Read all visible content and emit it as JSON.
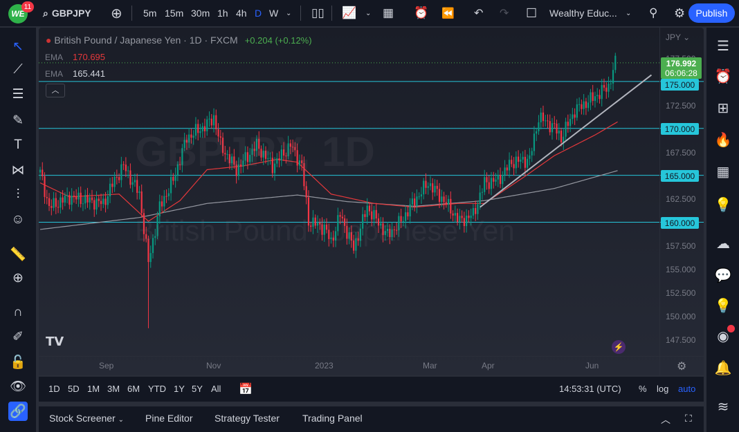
{
  "topbar": {
    "logo": "WE",
    "notifications": "11",
    "symbol": "GBPJPY",
    "intervals": [
      "5m",
      "15m",
      "30m",
      "1h",
      "4h",
      "D",
      "W"
    ],
    "active_interval": "D",
    "layout_name": "Wealthy Educ...",
    "publish": "Publish"
  },
  "legend": {
    "title": "British Pound / Japanese Yen · 1D · FXCM",
    "change": "+0.204 (+0.12%)",
    "ema1_label": "EMA",
    "ema1_value": "170.695",
    "ema2_label": "EMA",
    "ema2_value": "165.441"
  },
  "watermark": {
    "symbol": "GBPJPY, 1D",
    "name": "British Pound / Japanese Yen"
  },
  "price_axis": {
    "currency": "JPY",
    "labels": [
      "177.500",
      "172.500",
      "167.500",
      "162.500",
      "157.500",
      "155.000",
      "152.500",
      "150.000",
      "147.500"
    ],
    "last_price": "176.992",
    "countdown": "06:06:28",
    "line_tags": [
      "175.000",
      "170.000",
      "165.000",
      "160.000"
    ]
  },
  "time_axis": {
    "labels": [
      "Sep",
      "Nov",
      "2023",
      "Mar",
      "Apr",
      "Jun"
    ]
  },
  "range_bar": {
    "ranges": [
      "1D",
      "5D",
      "1M",
      "3M",
      "6M",
      "YTD",
      "1Y",
      "5Y",
      "All"
    ],
    "clock": "14:53:31 (UTC)",
    "percent": "%",
    "log": "log",
    "auto": "auto"
  },
  "bottom_tabs": [
    "Stock Screener",
    "Pine Editor",
    "Strategy Tester",
    "Trading Panel"
  ],
  "colors": {
    "up": "#089981",
    "down": "#f23645",
    "ema_fast": "#e5383b",
    "ema_slow": "#9598a1",
    "hline": "#26c6da",
    "accent": "#2962ff"
  },
  "chart_data": {
    "type": "candlestick",
    "bars": 256,
    "ylim": [
      146,
      179
    ],
    "close_waypoints": [
      [
        0,
        165.3
      ],
      [
        4,
        161.6
      ],
      [
        13,
        162.7
      ],
      [
        28,
        162
      ],
      [
        33,
        164.5
      ],
      [
        37,
        166
      ],
      [
        44,
        163
      ],
      [
        48,
        155.7
      ],
      [
        53,
        161.6
      ],
      [
        59,
        164.5
      ],
      [
        65,
        169
      ],
      [
        74,
        170.4
      ],
      [
        77,
        171.2
      ],
      [
        80,
        168.2
      ],
      [
        87,
        165.6
      ],
      [
        96,
        168.2
      ],
      [
        103,
        166
      ],
      [
        111,
        168.2
      ],
      [
        116,
        166
      ],
      [
        119,
        160.1
      ],
      [
        126,
        159.4
      ],
      [
        129,
        157.9
      ],
      [
        133,
        160.8
      ],
      [
        139,
        157.2
      ],
      [
        145,
        161.6
      ],
      [
        154,
        158.6
      ],
      [
        160,
        160.1
      ],
      [
        166,
        162.3
      ],
      [
        172,
        164.2
      ],
      [
        179,
        162.3
      ],
      [
        186,
        160.1
      ],
      [
        192,
        160.8
      ],
      [
        197,
        164.2
      ],
      [
        203,
        164.5
      ],
      [
        209,
        166.4
      ],
      [
        217,
        166.7
      ],
      [
        221,
        171.2
      ],
      [
        228,
        170.1
      ],
      [
        231,
        169
      ],
      [
        237,
        171.9
      ],
      [
        246,
        173.4
      ],
      [
        252,
        174.5
      ],
      [
        255,
        176.99
      ]
    ],
    "ema_fast": [
      [
        0,
        164.2
      ],
      [
        13,
        162.7
      ],
      [
        35,
        163
      ],
      [
        48,
        160.1
      ],
      [
        62,
        162.3
      ],
      [
        74,
        165.6
      ],
      [
        90,
        166
      ],
      [
        105,
        166.7
      ],
      [
        114,
        166.4
      ],
      [
        129,
        163
      ],
      [
        148,
        162
      ],
      [
        166,
        161.6
      ],
      [
        185,
        162
      ],
      [
        197,
        162
      ],
      [
        215,
        164.9
      ],
      [
        228,
        167.1
      ],
      [
        246,
        169.3
      ],
      [
        256,
        170.7
      ]
    ],
    "ema_slow": [
      [
        -1,
        159.2
      ],
      [
        44,
        160.5
      ],
      [
        74,
        162
      ],
      [
        114,
        162.9
      ],
      [
        136,
        162.2
      ],
      [
        166,
        161.7
      ],
      [
        197,
        162.3
      ],
      [
        228,
        163.6
      ],
      [
        256,
        165.5
      ]
    ],
    "hlines": [
      175,
      170,
      165,
      160
    ],
    "trendline": [
      [
        195,
        161.6
      ],
      [
        271,
        175.7
      ]
    ],
    "low_wick": [
      48,
      148.7
    ]
  }
}
